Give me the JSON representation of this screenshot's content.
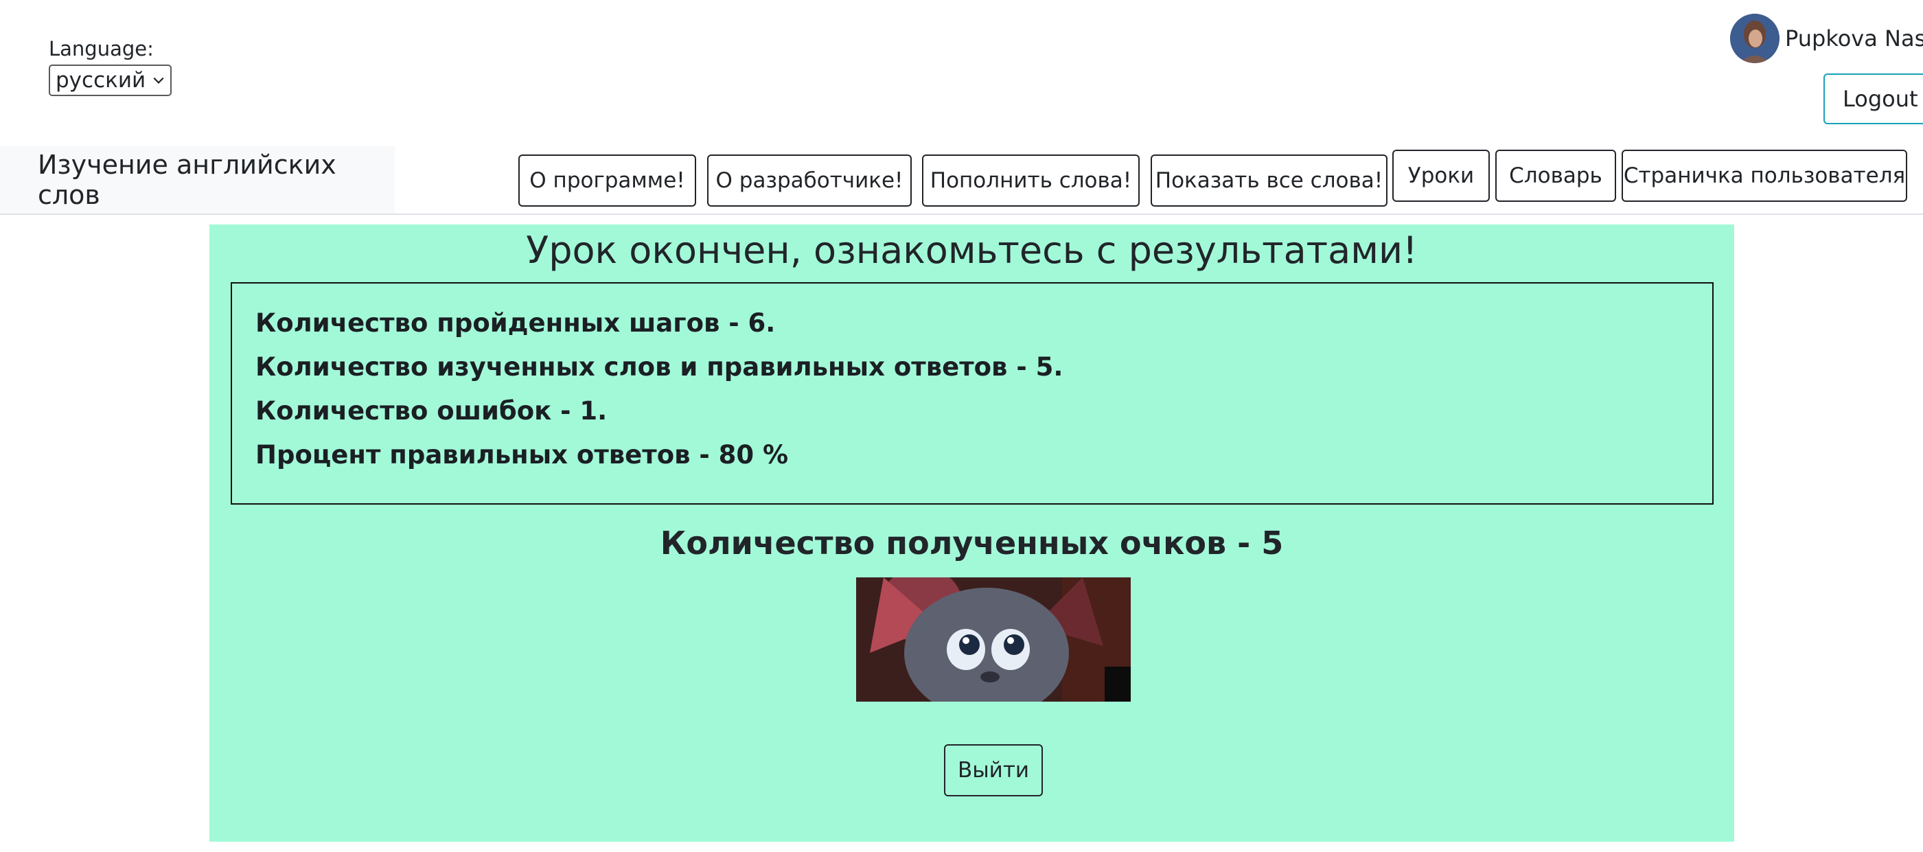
{
  "language": {
    "label": "Language:",
    "selected": "русский"
  },
  "user": {
    "name": "Pupkova Nasty",
    "logout_label": "Logout"
  },
  "navbar": {
    "brand": "Изучение английских слов",
    "items": [
      {
        "label": "О программе!"
      },
      {
        "label": "О разработчике!"
      },
      {
        "label": "Пополнить слова!"
      },
      {
        "label": "Показать все слова!"
      },
      {
        "label": "Уроки"
      },
      {
        "label": "Словарь"
      },
      {
        "label": "Страничка пользователя"
      }
    ]
  },
  "result": {
    "title": "Урок окончен, ознакомьтесь с результатами!",
    "stats": [
      "Количество пройденных шагов - 6.",
      "Количество изученных слов и правильных ответов - 5.",
      "Количество ошибок - 1.",
      "Процент правильных ответов - 80 %"
    ],
    "points": "Количество полученных очков - 5",
    "exit_label": "Выйти"
  },
  "colors": {
    "panel_bg": "#a2f9d8",
    "logout_border": "#17a2b8",
    "navbar_brand_bg": "#f8f9fa"
  }
}
